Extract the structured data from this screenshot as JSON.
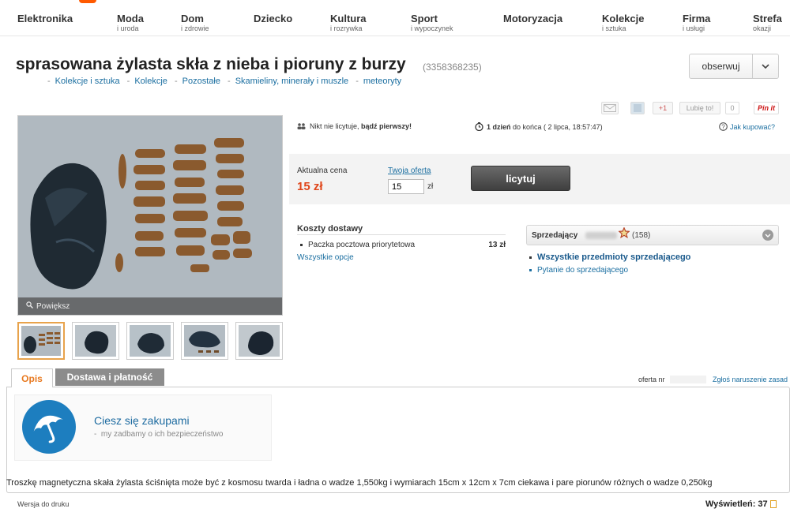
{
  "colors": {
    "accent": "#ff5a00",
    "price": "#e0461a",
    "link": "#1a6ea0",
    "bid_button": "#4a4a4a"
  },
  "nav": {
    "categories": [
      {
        "main": "Elektronika",
        "sub": ""
      },
      {
        "main": "Moda",
        "sub": "i uroda"
      },
      {
        "main": "Dom",
        "sub": "i zdrowie"
      },
      {
        "main": "Dziecko",
        "sub": ""
      },
      {
        "main": "Kultura",
        "sub": "i rozrywka"
      },
      {
        "main": "Sport",
        "sub": "i wypoczynek"
      },
      {
        "main": "Motoryzacja",
        "sub": ""
      },
      {
        "main": "Kolekcje",
        "sub": "i sztuka"
      },
      {
        "main": "Firma",
        "sub": "i usługi"
      },
      {
        "main": "Strefa",
        "sub": "okazji"
      }
    ]
  },
  "item": {
    "title": "sprasowana żylasta skła z nieba i pioruny z burzy",
    "number": "(3358368235)",
    "watch_label": "obserwuj",
    "breadcrumbs": [
      "Kolekcje i sztuka",
      "Kolekcje",
      "Pozostałe",
      "Skamieliny, minerały i muszle",
      "meteoryty"
    ]
  },
  "social": {
    "gplus": "+1",
    "like": "Lubię to!",
    "like_count": "0",
    "pinit": "Pin it"
  },
  "gallery": {
    "zoom_label": "Powiększ",
    "icon": "magnifier-icon"
  },
  "auction": {
    "bidders_text_pre": "Nikt nie licytuje, ",
    "bidders_text_bold": "bądź pierwszy!",
    "time_bold": "1 dzień",
    "time_rest": " do końca ( 2 lipca, 18:57:47)",
    "how_to_buy": "Jak kupować?",
    "price_label": "Aktualna cena",
    "price": "15 zł",
    "offer_label": "Twoja oferta",
    "offer_value": "15",
    "offer_currency": "zł",
    "bid_button": "licytuj"
  },
  "shipping": {
    "title": "Koszty dostawy",
    "options": [
      {
        "name": "Paczka pocztowa priorytetowa",
        "price": "13 zł"
      }
    ],
    "all_options": "Wszystkie opcje"
  },
  "seller": {
    "label": "Sprzedający",
    "rating_count": "(158)",
    "all_items": "Wszystkie przedmioty sprzedającego",
    "ask": "Pytanie do sprzedającego"
  },
  "tabs": {
    "description": "Opis",
    "delivery": "Dostawa i płatność"
  },
  "offer_nr_label": "oferta nr",
  "report_label": "Zgłoś naruszenie zasad",
  "promo": {
    "title": "Ciesz się zakupami",
    "subtitle": "my zadbamy o ich bezpieczeństwo"
  },
  "description": "Troszkę magnetyczna skała żylasta ściśnięta może być z kosmosu twarda i ładna o wadze 1,550kg i wymiarach 15cm x 12cm x 7cm ciekawa i pare piorunów różnych o wadze 0,250kg",
  "footer": {
    "print_version": "Wersja do druku",
    "views": "Wyświetleń: 37"
  }
}
